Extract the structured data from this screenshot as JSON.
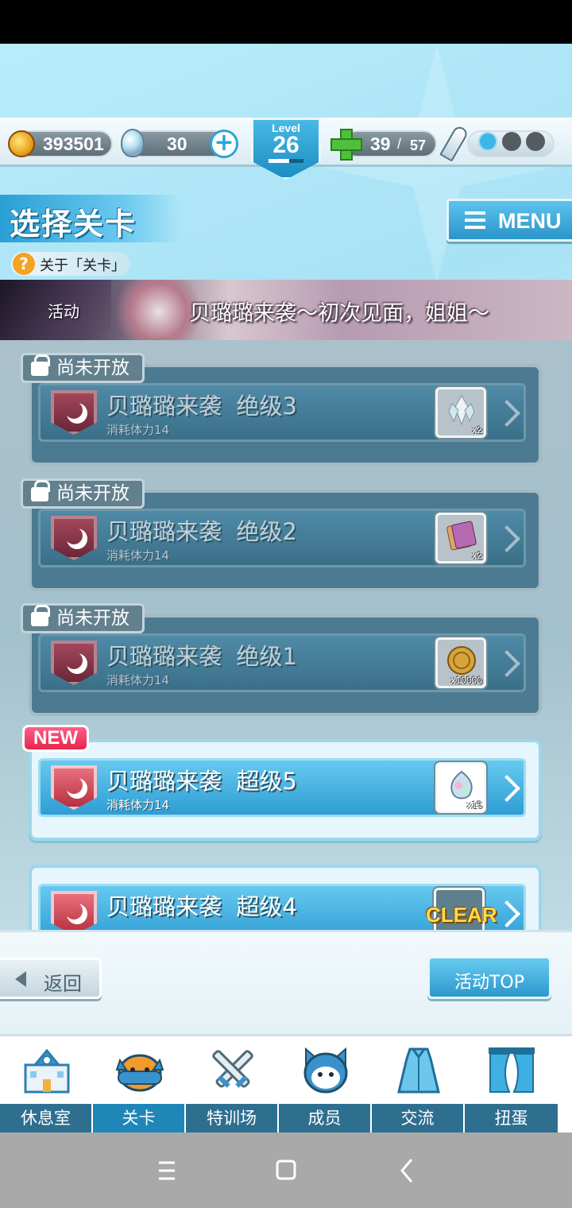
{
  "resources": {
    "coins": "393501",
    "gems": "30",
    "level_label": "Level",
    "level_value": "26",
    "stamina_current": "39",
    "stamina_sep": "/",
    "stamina_max": "57"
  },
  "header": {
    "title": "选择关卡",
    "about": "关于「关卡」",
    "menu_label": "MENU"
  },
  "event": {
    "tag": "活动",
    "title": "贝璐璐来袭～初次见面，姐姐～"
  },
  "stages": [
    {
      "name": "贝璐璐来袭  绝级3",
      "cost": "消耗体力14",
      "reward_icon": "crystal-cluster-icon",
      "reward_qty": "x2",
      "locked": true,
      "lock_label": "尚未开放"
    },
    {
      "name": "贝璐璐来袭  绝级2",
      "cost": "消耗体力14",
      "reward_icon": "ticket-icon",
      "reward_qty": "x2",
      "locked": true,
      "lock_label": "尚未开放"
    },
    {
      "name": "贝璐璐来袭  绝级1",
      "cost": "消耗体力14",
      "reward_icon": "gold-coin-icon",
      "reward_qty": "x10000",
      "locked": true,
      "lock_label": "尚未开放"
    },
    {
      "name": "贝璐璐来袭  超级5",
      "cost": "消耗体力14",
      "reward_icon": "rainbow-gem-icon",
      "reward_qty": "x15",
      "locked": false,
      "badge": "NEW"
    },
    {
      "name": "贝璐璐来袭  超级4",
      "cost": "",
      "reward_icon": "reward-icon",
      "reward_qty": "",
      "locked": false,
      "status": "CLEAR"
    }
  ],
  "footer": {
    "back_label": "返回",
    "top_label": "活动TOP"
  },
  "nav": [
    {
      "label": "休息室",
      "icon": "school-building-icon"
    },
    {
      "label": "关卡",
      "icon": "devil-mascot-icon",
      "active": true
    },
    {
      "label": "特训场",
      "icon": "crossed-swords-icon"
    },
    {
      "label": "成员",
      "icon": "cat-mascot-icon"
    },
    {
      "label": "交流",
      "icon": "dress-icon"
    },
    {
      "label": "扭蛋",
      "icon": "curtain-icon"
    }
  ],
  "colors": {
    "accent": "#2b95c9",
    "locked_stage": "#4c7b91",
    "new_badge": "#e5264e",
    "clear_text": "#ffd84a"
  }
}
